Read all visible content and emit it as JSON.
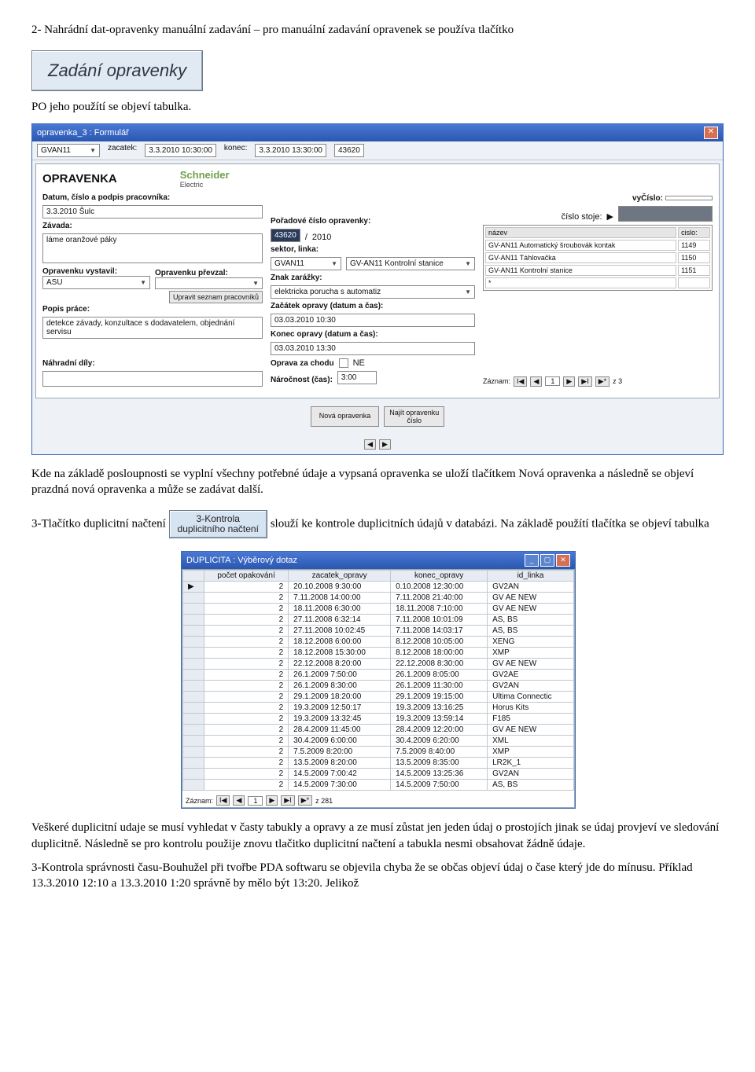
{
  "doc": {
    "para1": "2- Nahrádní dat-opravenky manuální zadavání – pro manuální zadavání opravenek se používa tlačítko",
    "btn_zadani": "Zadání opravenky",
    "para2": "PO jeho použítí se objeví tabulka.",
    "para3": "Kde na základě posloupnosti se vyplní všechny potřebné údaje a vypsaná opravenka se uloží tlačítkem Nová opravenka a následně se objeví prazdná nová opravenka a může se zadávat další.",
    "para4a": "3-Tlačítko duplicitní načtení ",
    "btn_kontrola": "3-Kontrola\nduplicitního načtení",
    "para4b": " slouží ke kontrole duplicitních údajů v databázi. Na základě použítí tlačítka se objeví tabulka",
    "para5": "Veškeré duplicitní udaje se musí vyhledat v časty tabukly a opravy a ze musí zůstat jen jeden údaj o prostojích jinak se údaj provjeví ve sledování duplicitně. Následně se pro kontrolu použije znovu tlačitko duplicitní načtení a tabukla nesmi obsahovat žádně údaje.",
    "para6": "3-Kontrola správnosti času-Bouhužel při tvořbe PDA softwaru se objevila chyba že se občas objeví údaj o čase který jde do mínusu. Příklad 13.3.2010 12:10 a 13.3.2010 1:20 správně by mělo být 13:20. Jelikož"
  },
  "form": {
    "window_title": "opravenka_3 : Formulář",
    "top": {
      "linka": "GVAN11",
      "zacatek_lbl": "zacatek:",
      "zacatek": "3.3.2010 10:30:00",
      "konec_lbl": "konec:",
      "konec": "3.3.2010 13:30:00",
      "cislo": "43620"
    },
    "title": "OPRAVENKA",
    "brand": "Schneider",
    "brand2": "Electric",
    "leftcol": {
      "datum_lbl": "Datum, číslo a podpis pracovníka:",
      "datum": "3.3.2010 Šulc",
      "zavada_lbl": "Závada:",
      "zavada": "láme oranžové páky",
      "vystavil_lbl": "Opravenku vystavil:",
      "vystavil": "ASU",
      "prevzal_lbl": "Opravenku převzal:",
      "prevzal": "",
      "upravit_btn": "Upravit seznam pracovníků",
      "popis_lbl": "Popis práce:",
      "popis": "detekce závady, konzultace s dodavatelem, objednání servisu",
      "dily_lbl": "Náhradní díly:"
    },
    "midcol": {
      "porad_lbl": "Pořadové číslo opravenky:",
      "porad": "43620",
      "porad_year": "2010",
      "sektor_lbl": "sektor, linka:",
      "sektor": "GVAN11",
      "sektor2": "GV-AN11 Kontrolní stanice",
      "znak_lbl": "Znak zarážky:",
      "znak": "elektricka porucha s automatiz",
      "zac_lbl": "Začátek opravy (datum a čas):",
      "zac": "03.03.2010 10:30",
      "kon_lbl": "Konec opravy (datum a čas):",
      "kon": "03.03.2010 13:30",
      "chodu_lbl": "Oprava za chodu",
      "chodu_val": "NE",
      "naroc_lbl": "Náročnost (čas):",
      "naroc": "3:00"
    },
    "rightcol": {
      "vycislo_lbl": "vyČíslo:",
      "stoj_lbl": "číslo stoje:",
      "th_nazev": "název",
      "th_cislo": "cislo:",
      "rows": [
        {
          "n": "GV-AN11 Automatický šroubovák kontak",
          "c": "1149"
        },
        {
          "n": "GV-AN11 Táhlovačka",
          "c": "1150"
        },
        {
          "n": "GV-AN11 Kontrolní stanice",
          "c": "1151"
        }
      ],
      "zaznam_lbl": "Záznam:",
      "zaznam_pos": "1",
      "zaznam_total": "z 3"
    },
    "buttons": {
      "nova": "Nová opravenka",
      "najit": "Najít opravenku\nčíslo"
    }
  },
  "dup": {
    "window_title": "DUPLICITA : Výběrový dotaz",
    "cols": [
      "",
      "počet opakování",
      "zacatek_opravy",
      "konec_opravy",
      "id_linka"
    ],
    "rows": [
      [
        "2",
        "20.10.2008 9:30:00",
        "0.10.2008 12:30:00",
        "GV2AN"
      ],
      [
        "2",
        "7.11.2008 14:00:00",
        "7.11.2008 21:40:00",
        "GV AE NEW"
      ],
      [
        "2",
        "18.11.2008 6:30:00",
        "18.11.2008 7:10:00",
        "GV AE NEW"
      ],
      [
        "2",
        "27.11.2008 6:32:14",
        "7.11.2008 10:01:09",
        "AS, BS"
      ],
      [
        "2",
        "27.11.2008 10:02:45",
        "7.11.2008 14:03:17",
        "AS, BS"
      ],
      [
        "2",
        "18.12.2008 6:00:00",
        "8.12.2008 10:05:00",
        "XENG"
      ],
      [
        "2",
        "18.12.2008 15:30:00",
        "8.12.2008 18:00:00",
        "XMP"
      ],
      [
        "2",
        "22.12.2008 8:20:00",
        "22.12.2008 8:30:00",
        "GV AE NEW"
      ],
      [
        "2",
        "26.1.2009 7:50:00",
        "26.1.2009 8:05:00",
        "GV2AE"
      ],
      [
        "2",
        "26.1.2009 8:30:00",
        "26.1.2009 11:30:00",
        "GV2AN"
      ],
      [
        "2",
        "29.1.2009 18:20:00",
        "29.1.2009 19:15:00",
        "Ultima Connectic"
      ],
      [
        "2",
        "19.3.2009 12:50:17",
        "19.3.2009 13:16:25",
        "Horus Kits"
      ],
      [
        "2",
        "19.3.2009 13:32:45",
        "19.3.2009 13:59:14",
        "F185"
      ],
      [
        "2",
        "28.4.2009 11:45:00",
        "28.4.2009 12:20:00",
        "GV AE NEW"
      ],
      [
        "2",
        "30.4.2009 6:00:00",
        "30.4.2009 6:20:00",
        "XML"
      ],
      [
        "2",
        "7.5.2009 8:20:00",
        "7.5.2009 8:40:00",
        "XMP"
      ],
      [
        "2",
        "13.5.2009 8:20:00",
        "13.5.2009 8:35:00",
        "LR2K_1"
      ],
      [
        "2",
        "14.5.2009 7:00:42",
        "14.5.2009 13:25:36",
        "GV2AN"
      ],
      [
        "2",
        "14.5.2009 7:30:00",
        "14.5.2009 7:50:00",
        "AS, BS"
      ]
    ],
    "nav": {
      "lbl": "Záznam:",
      "pos": "1",
      "total": "z 281"
    }
  }
}
